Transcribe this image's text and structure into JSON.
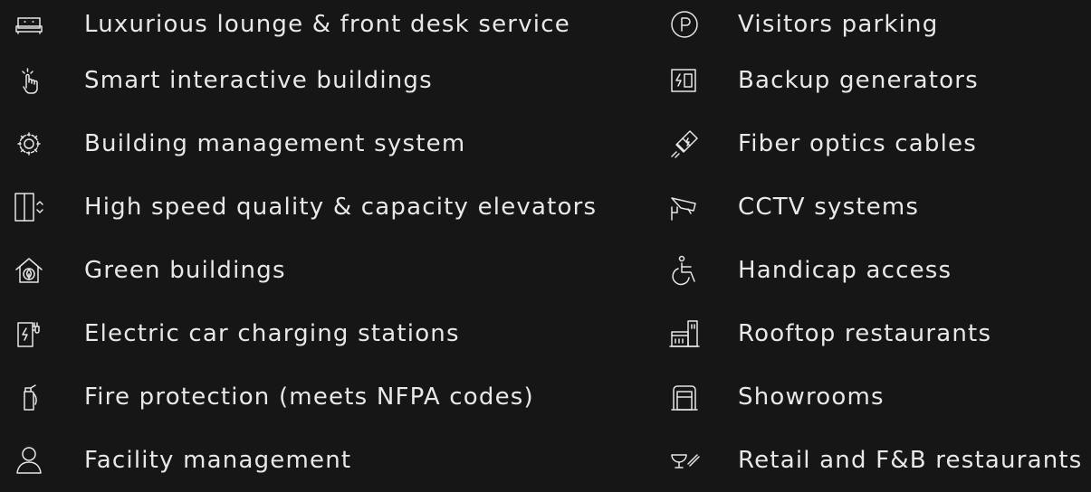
{
  "amenities": {
    "left": [
      {
        "label": "Luxurious lounge & front desk service",
        "icon": "sofa-icon"
      },
      {
        "label": "Smart interactive buildings",
        "icon": "touch-icon"
      },
      {
        "label": "Building management system",
        "icon": "gear-icon"
      },
      {
        "label": "High speed quality & capacity elevators",
        "icon": "elevator-icon"
      },
      {
        "label": "Green buildings",
        "icon": "green-house-icon"
      },
      {
        "label": "Electric car charging stations",
        "icon": "ev-charger-icon"
      },
      {
        "label": "Fire protection (meets NFPA codes)",
        "icon": "fire-extinguisher-icon"
      },
      {
        "label": "Facility management",
        "icon": "person-icon"
      }
    ],
    "right": [
      {
        "label": "Visitors parking",
        "icon": "parking-icon"
      },
      {
        "label": "Backup generators",
        "icon": "generator-icon"
      },
      {
        "label": "Fiber optics cables",
        "icon": "fiber-cable-icon"
      },
      {
        "label": "CCTV systems",
        "icon": "cctv-camera-icon"
      },
      {
        "label": "Handicap access",
        "icon": "wheelchair-icon"
      },
      {
        "label": "Rooftop restaurants",
        "icon": "rooftop-building-icon"
      },
      {
        "label": "Showrooms",
        "icon": "showroom-icon"
      },
      {
        "label": "Retail and F&B restaurants",
        "icon": "dining-icon"
      }
    ]
  }
}
